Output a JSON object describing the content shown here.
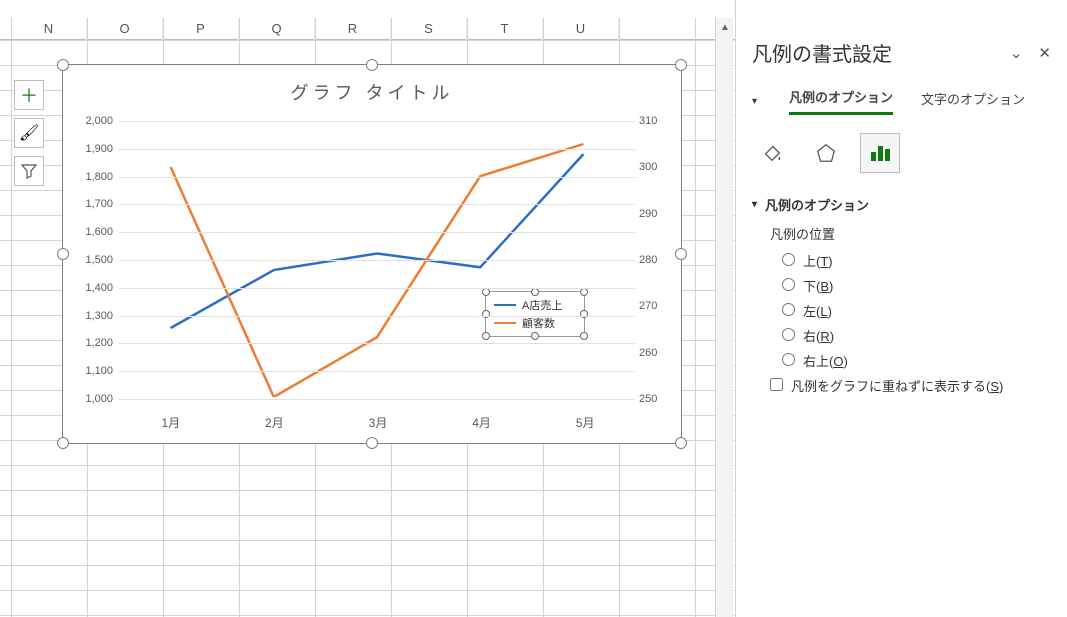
{
  "columns": [
    "N",
    "O",
    "P",
    "Q",
    "R",
    "S",
    "T",
    "U"
  ],
  "mini_tools": {
    "add": "＋",
    "brush": "🖌",
    "filter": "⏷"
  },
  "panel": {
    "title": "凡例の書式設定",
    "tab_options": "凡例のオプション",
    "tab_text": "文字のオプション",
    "section_title": "凡例のオプション",
    "position_label": "凡例の位置",
    "radios": {
      "top": "上(T)",
      "bottom": "下(B)",
      "left": "左(L)",
      "right": "右(R)",
      "topright": "右上(O)"
    },
    "overlap_chk": "凡例をグラフに重ねずに表示する(S)"
  },
  "chart_data": {
    "type": "line",
    "title": "グラフ タイトル",
    "categories": [
      "1月",
      "2月",
      "3月",
      "4月",
      "5月"
    ],
    "series": [
      {
        "name": "A店売上",
        "axis": "left",
        "color": "#2b6fc4",
        "values": [
          1250,
          1460,
          1520,
          1470,
          1880
        ]
      },
      {
        "name": "顧客数",
        "axis": "right",
        "color": "#ed7d31",
        "values": [
          300,
          250,
          263,
          298,
          305
        ]
      }
    ],
    "y_left": {
      "min": 1000,
      "max": 2000,
      "step": 100,
      "ticks": [
        2000,
        1900,
        1800,
        1700,
        1600,
        1500,
        1400,
        1300,
        1200,
        1100,
        1000
      ]
    },
    "y_right": {
      "min": 250,
      "max": 310,
      "step": 10,
      "ticks": [
        310,
        300,
        290,
        280,
        270,
        260,
        250
      ]
    }
  }
}
